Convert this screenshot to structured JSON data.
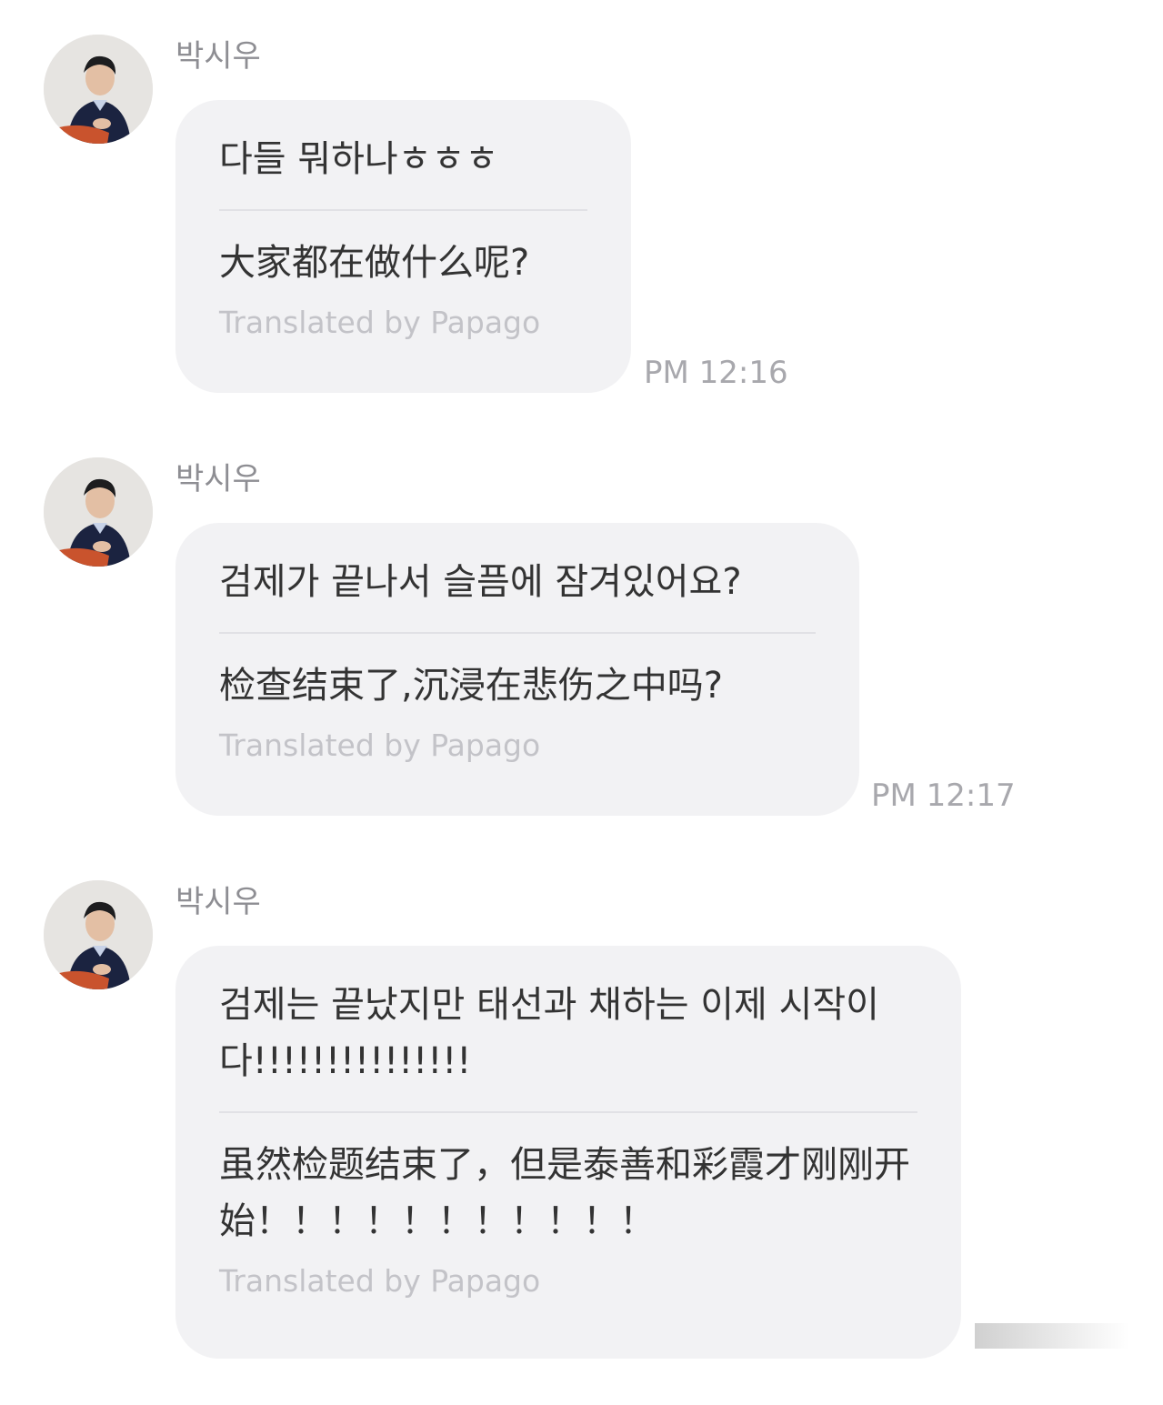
{
  "chat": {
    "messages": [
      {
        "sender": "박시우",
        "original": "다들 뭐하나ㅎㅎㅎ",
        "translation": "大家都在做什么呢?",
        "credit": "Translated by Papago",
        "time": "PM 12:16"
      },
      {
        "sender": "박시우",
        "original": "검제가 끝나서 슬픔에 잠겨있어요?",
        "translation": "检查结束了,沉浸在悲伤之中吗?",
        "credit": "Translated by Papago",
        "time": "PM 12:17"
      },
      {
        "sender": "박시우",
        "original": "검제는 끝났지만 태선과 채하는 이제 시작이다!!!!!!!!!!!!!!!",
        "translation": "虽然检题结束了，但是泰善和彩霞才刚刚开始！！！！！！！！！！！",
        "credit": "Translated by Papago"
      }
    ]
  },
  "colors": {
    "bubble": "#f2f2f4",
    "text": "#333333",
    "sender": "#8e8e93",
    "credit": "#c3c3c8",
    "time": "#a8a8ad"
  },
  "icons": {
    "avatar": "profile-photo"
  }
}
